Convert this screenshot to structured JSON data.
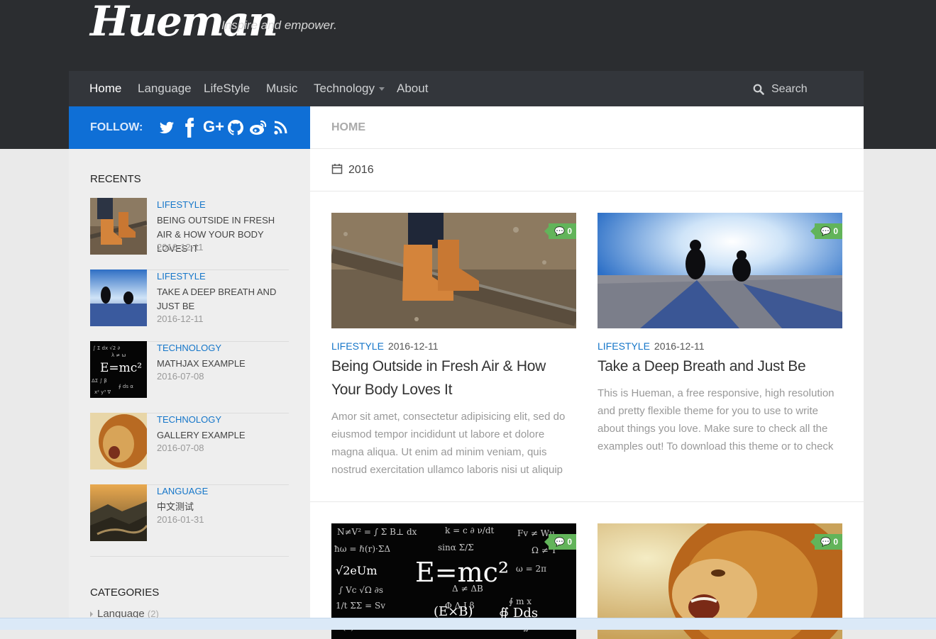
{
  "site": {
    "title": "Hueman",
    "tagline": "Inspire and empower."
  },
  "nav": {
    "items": [
      {
        "label": "Home"
      },
      {
        "label": "Language"
      },
      {
        "label": "LifeStyle"
      },
      {
        "label": "Music"
      },
      {
        "label": "Technology"
      },
      {
        "label": "About"
      }
    ],
    "search_placeholder": "Search"
  },
  "follow": {
    "label": "FOLLOW:",
    "icons": [
      "twitter-icon",
      "facebook-icon",
      "google-plus-icon",
      "github-icon",
      "weibo-icon",
      "rss-icon"
    ]
  },
  "sidebar": {
    "recents_title": "RECENTS",
    "recents": [
      {
        "category": "LIFESTYLE",
        "title": "BEING OUTSIDE IN FRESH AIR & HOW YOUR BODY LOVES IT",
        "date": "2016-12-11"
      },
      {
        "category": "LIFESTYLE",
        "title": "TAKE A DEEP BREATH AND JUST BE",
        "date": "2016-12-11"
      },
      {
        "category": "TECHNOLOGY",
        "title": "MATHJAX EXAMPLE",
        "date": "2016-07-08"
      },
      {
        "category": "TECHNOLOGY",
        "title": "GALLERY EXAMPLE",
        "date": "2016-07-08"
      },
      {
        "category": "LANGUAGE",
        "title": "中文测试",
        "date": "2016-01-31"
      }
    ],
    "categories_title": "CATEGORIES",
    "categories": [
      {
        "label": "Language",
        "count": "(2)"
      }
    ]
  },
  "main": {
    "breadcrumb": "HOME",
    "archive": "2016",
    "posts": [
      {
        "category": "LIFESTYLE",
        "date": "2016-12-11",
        "title": "Being Outside in Fresh Air & How Your Body Loves It",
        "excerpt": "Amor sit amet, consectetur adipisicing elit, sed do eiusmod tempor incididunt ut labore et dolore magna aliqua. Ut enim ad minim veniam, quis nostrud exercitation ullamco laboris nisi ut aliquip",
        "comments": "0"
      },
      {
        "category": "LIFESTYLE",
        "date": "2016-12-11",
        "title": "Take a Deep Breath and Just Be",
        "excerpt": "This is Hueman, a free responsive, high resolution and pretty flexible theme for you to use to write about things you love. Make sure to check all the examples out! To download this theme or to check",
        "comments": "0"
      },
      {
        "comments": "0",
        "image_text": "E=mc²"
      },
      {
        "comments": "0"
      }
    ]
  },
  "colors": {
    "header_bg": "#2b2d30",
    "nav_bg": "#33363b",
    "follow_bg": "#0f6fd6",
    "link": "#1576c9",
    "comment_badge": "#62b45a"
  }
}
